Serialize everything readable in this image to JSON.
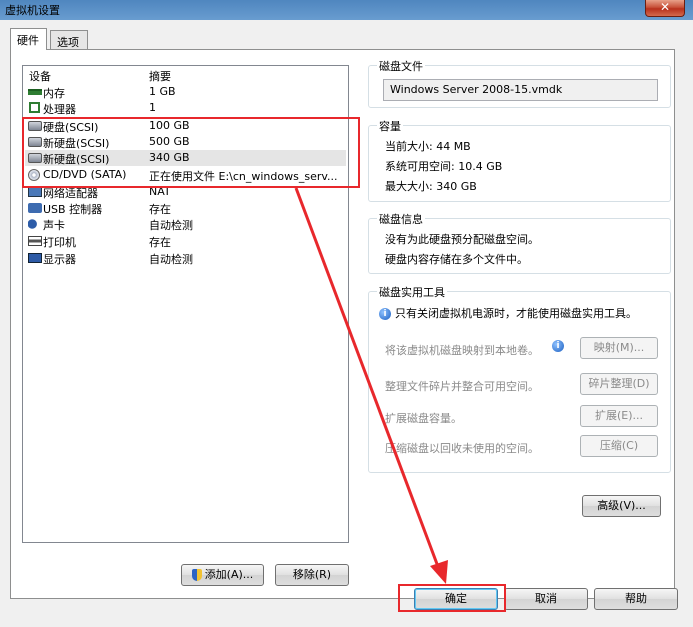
{
  "window": {
    "title": "虚拟机设置",
    "close_label": "✕"
  },
  "tabs": [
    {
      "label": "硬件"
    },
    {
      "label": "选项"
    }
  ],
  "device_list": {
    "headers": {
      "device": "设备",
      "summary": "摘要"
    },
    "rows": [
      {
        "name": "内存",
        "summary": "1 GB",
        "icon": "memory-icon"
      },
      {
        "name": "处理器",
        "summary": "1",
        "icon": "processor-icon"
      },
      {
        "name": "硬盘(SCSI)",
        "summary": "100 GB",
        "icon": "hard-disk-icon"
      },
      {
        "name": "新硬盘(SCSI)",
        "summary": "500 GB",
        "icon": "hard-disk-icon"
      },
      {
        "name": "新硬盘(SCSI)",
        "summary": "340 GB",
        "icon": "hard-disk-icon"
      },
      {
        "name": "CD/DVD (SATA)",
        "summary": "正在使用文件 E:\\cn_windows_serv...",
        "icon": "cd-dvd-icon"
      },
      {
        "name": "网络适配器",
        "summary": "NAT",
        "icon": "network-adapter-icon"
      },
      {
        "name": "USB 控制器",
        "summary": "存在",
        "icon": "usb-icon"
      },
      {
        "name": "声卡",
        "summary": "自动检测",
        "icon": "sound-card-icon"
      },
      {
        "name": "打印机",
        "summary": "存在",
        "icon": "printer-icon"
      },
      {
        "name": "显示器",
        "summary": "自动检测",
        "icon": "display-icon"
      }
    ]
  },
  "list_buttons": {
    "add_label": "添加(A)...",
    "remove_label": "移除(R)"
  },
  "disk_file": {
    "title": "磁盘文件",
    "value": "Windows Server 2008-15.vmdk"
  },
  "capacity": {
    "title": "容量",
    "current": "当前大小: 44 MB",
    "available": "系统可用空间: 10.4 GB",
    "max": "最大大小: 340 GB"
  },
  "disk_info": {
    "title": "磁盘信息",
    "line1": "没有为此硬盘预分配磁盘空间。",
    "line2": "硬盘内容存储在多个文件中。"
  },
  "disk_utils": {
    "title": "磁盘实用工具",
    "notice": "只有关闭虚拟机电源时，才能使用磁盘实用工具。",
    "map_desc": "将该虚拟机磁盘映射到本地卷。",
    "map_btn": "映射(M)...",
    "defrag_desc": "整理文件碎片并整合可用空间。",
    "defrag_btn": "碎片整理(D)",
    "expand_desc": "扩展磁盘容量。",
    "expand_btn": "扩展(E)...",
    "compact_desc": "压缩磁盘以回收未使用的空间。",
    "compact_btn": "压缩(C)",
    "advanced_btn": "高级(V)..."
  },
  "footer": {
    "ok_label": "确定",
    "cancel_label": "取消",
    "help_label": "帮助"
  },
  "colors": {
    "annotation_red": "#e8282c",
    "selected_row": "#e5e5e5"
  }
}
